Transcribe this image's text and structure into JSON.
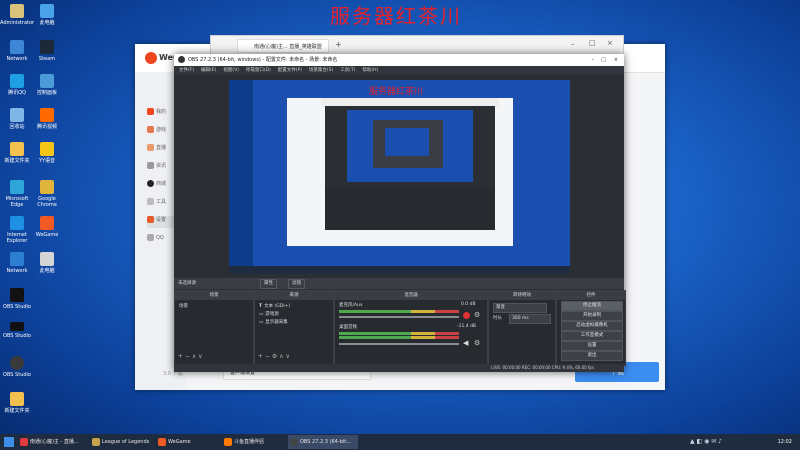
{
  "watermark": "服务器红茶川",
  "desktop": {
    "icons": [
      {
        "label": "Administrator",
        "color": "#d9c27a"
      },
      {
        "label": "此电脑",
        "color": "#4aa3e8"
      },
      {
        "label": "Network",
        "color": "#3d86d6"
      },
      {
        "label": "腾讯QQ",
        "color": "#1fa0e5"
      },
      {
        "label": "回收站",
        "color": "#7fb6e6"
      },
      {
        "label": "控制面板",
        "color": "#4d9ad9"
      },
      {
        "label": "Microsoft Edge",
        "color": "#2ea7d8"
      },
      {
        "label": "Google Chrome",
        "color": "#e0b33a"
      },
      {
        "label": "Internet Explorer",
        "color": "#1e90e3"
      },
      {
        "label": "WeGame",
        "color": "#f15a24"
      },
      {
        "label": "YY语音",
        "color": "#f5c518"
      },
      {
        "label": "Steam",
        "color": "#1b2838"
      },
      {
        "label": "腾讯视频",
        "color": "#ff6a00"
      },
      {
        "label": "OBS Studio",
        "color": "#3a3a3a"
      },
      {
        "label": "新建文件夹",
        "color": "#f2c14e"
      }
    ]
  },
  "wegame": {
    "logo_text": "WeGame",
    "sidebar": [
      "我的",
      "游戏",
      "直播",
      "资讯",
      "商城",
      "工具",
      "设置",
      "QQ"
    ],
    "bottom_text": "客户端设置",
    "bottom_left": "3.0 下载",
    "download_label": "下载"
  },
  "browser": {
    "tab_label": "南通(心魔)主... 直播_英雄联盟",
    "new_tab": "+"
  },
  "obs": {
    "title": "OBS 27.2.3 (64-bit, windows) - 配置文件: 未命名 - 场景: 未命名",
    "menu": [
      "文件(F)",
      "编辑(E)",
      "视图(V)",
      "停靠窗口(D)",
      "配置文件(P)",
      "场景集合(S)",
      "工具(T)",
      "帮助(H)"
    ],
    "no_source": "未选择源",
    "props_label": "属性",
    "filters_label": "滤镜",
    "docks": {
      "scenes_title": "场景",
      "scenes": [
        "场景"
      ],
      "sources_title": "来源",
      "sources": [
        "文本 (GDI+)",
        "游戏源",
        "显示器采集"
      ],
      "mixer_title": "混音器",
      "mixer": [
        {
          "name": "麦克风/Aux",
          "db": "0.0 dB"
        },
        {
          "name": "桌面音频",
          "db": "-11.4 dB"
        }
      ],
      "transition_title": "转场特效",
      "transition_type": "渐变",
      "duration_label": "时长",
      "duration_value": "300 ms",
      "controls_title": "控件",
      "controls": [
        "停止推流",
        "开始录制",
        "启动虚拟摄像机",
        "工作室模式",
        "设置",
        "退出"
      ]
    },
    "status": "LIVE: 00:00:00   REC: 00:00:00   CPU: 9.4%, 60.00 fps"
  },
  "taskbar": {
    "items": [
      {
        "label": "南通(心魔)主 - 直播...",
        "color": "#e33b3b"
      },
      {
        "label": "League of Legends",
        "color": "#c8a24a"
      },
      {
        "label": "WeGame",
        "color": "#f15a24"
      },
      {
        "label": "斗鱼直播伴侣",
        "color": "#ff7b00"
      },
      {
        "label": "OBS 27.2.3 (64-bit...",
        "color": "#444"
      }
    ],
    "clock": "12:02"
  }
}
